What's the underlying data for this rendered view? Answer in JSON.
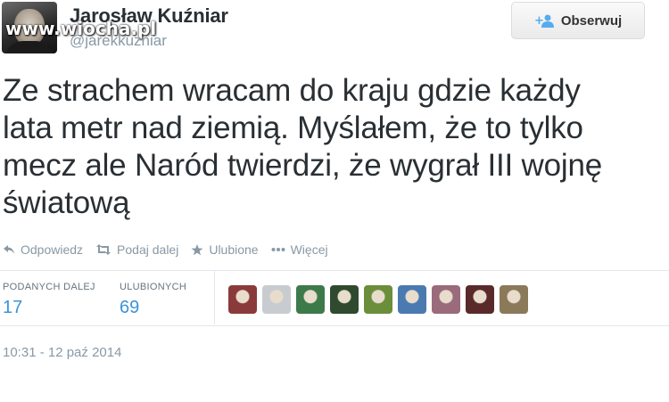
{
  "user": {
    "name": "Jarosław Kuźniar",
    "handle": "@jarekkuzniar"
  },
  "watermark": "www.wiocha.pl",
  "follow_button": {
    "label": "Obserwuj",
    "icon": "add-user-icon"
  },
  "tweet": {
    "lines": [
      "Ze strachem wracam do kraju gdzie każdy",
      "lata metr nad ziemią. Myślałem, że to tylko",
      "mecz ale Naród twierdzi, że wygrał III wojnę",
      "światową"
    ]
  },
  "actions": [
    {
      "label": "Odpowiedz",
      "icon": "reply-icon"
    },
    {
      "label": "Podaj dalej",
      "icon": "retweet-icon"
    },
    {
      "label": "Ulubione",
      "icon": "star-icon"
    },
    {
      "label": "Więcej",
      "icon": "more-icon"
    }
  ],
  "stats": {
    "retweets_label": "PODANYCH DALEJ",
    "retweets_count": "17",
    "favorites_label": "ULUBIONYCH",
    "favorites_count": "69"
  },
  "favoriter_avatars": [
    {
      "color": "#8a3a3a"
    },
    {
      "color": "#c8ccd0"
    },
    {
      "color": "#3d7a4a"
    },
    {
      "color": "#2f4a2f"
    },
    {
      "color": "#6b8e3a"
    },
    {
      "color": "#4a7ab0"
    },
    {
      "color": "#9a6b7a"
    },
    {
      "color": "#5a2a2a"
    },
    {
      "color": "#8a7a5a"
    }
  ],
  "timestamp": "10:31 - 12 paź 2014"
}
